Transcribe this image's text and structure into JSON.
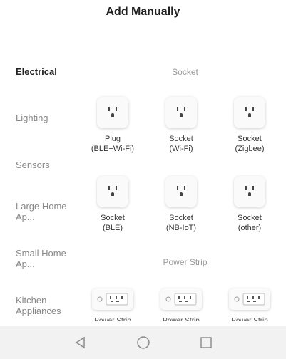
{
  "header": {
    "title": "Add Manually"
  },
  "sidebar": {
    "categories": [
      {
        "label": "Electrical",
        "active": true
      },
      {
        "label": "Lighting"
      },
      {
        "label": "Sensors"
      },
      {
        "label": "Large Home Ap..."
      },
      {
        "label": "Small Home Ap..."
      },
      {
        "label": "Kitchen Appliances"
      }
    ]
  },
  "sections": {
    "socket": {
      "title": "Socket",
      "items": [
        {
          "line1": "Plug",
          "line2": "(BLE+Wi-Fi)",
          "icon": "socket-icon"
        },
        {
          "line1": "Socket",
          "line2": "(Wi-Fi)",
          "icon": "socket-icon"
        },
        {
          "line1": "Socket",
          "line2": "(Zigbee)",
          "icon": "socket-icon"
        },
        {
          "line1": "Socket",
          "line2": "(BLE)",
          "icon": "socket-icon"
        },
        {
          "line1": "Socket",
          "line2": "(NB-IoT)",
          "icon": "socket-icon"
        },
        {
          "line1": "Socket",
          "line2": "(other)",
          "icon": "socket-icon"
        }
      ]
    },
    "power_strip": {
      "title": "Power Strip",
      "items": [
        {
          "label": "Power Strip",
          "icon": "power-strip-icon"
        },
        {
          "label": "Power Strip",
          "icon": "power-strip-icon"
        },
        {
          "label": "Power Strip",
          "icon": "power-strip-icon"
        }
      ]
    }
  },
  "navbar": {
    "icons": [
      "back-icon",
      "home-icon",
      "recents-icon"
    ]
  },
  "colors": {
    "active_text": "#222222",
    "inactive_text": "#888888",
    "navbar_bg": "#f2f2f2"
  }
}
